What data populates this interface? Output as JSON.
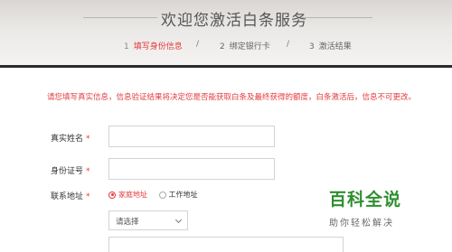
{
  "header": {
    "title": "欢迎您激活白条服务",
    "steps": [
      {
        "num": "1",
        "label": "填写身份信息"
      },
      {
        "num": "2",
        "label": "绑定银行卡"
      },
      {
        "num": "3",
        "label": "激活结果"
      }
    ],
    "separator": "/"
  },
  "notice": "请您填写真实信息，信息验证结果将决定您是否能获取白条及最终获得的额度，白条激活后，信息不可更改。",
  "form": {
    "name_label": "真实姓名",
    "id_label": "身份证号",
    "address_label": "联系地址",
    "required_mark": "*",
    "name_value": "",
    "id_value": "",
    "address_type_options": [
      "家庭地址",
      "工作地址"
    ],
    "address_type_selected": "家庭地址",
    "region_select": "请选择"
  },
  "watermark": {
    "title": "百科全说",
    "subtitle": "助你轻松解决"
  },
  "colors": {
    "accent": "#e4393c",
    "header_bar": "#2b2b2b",
    "watermark_green": "#2f8f2f"
  }
}
